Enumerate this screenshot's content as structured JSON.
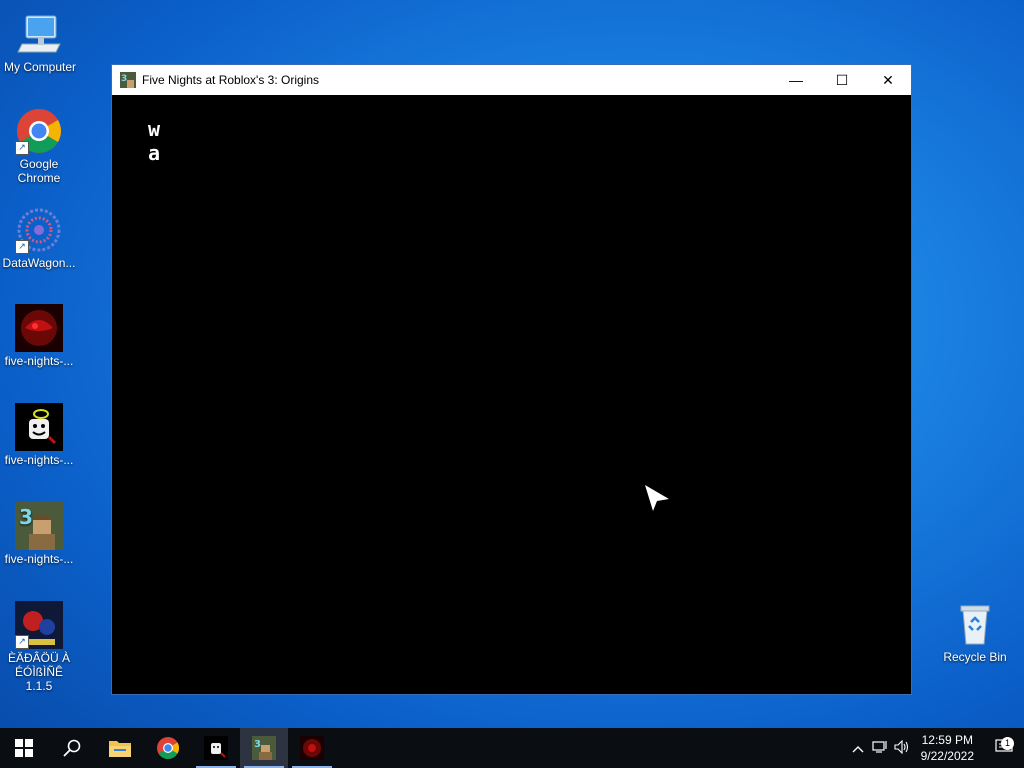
{
  "desktop": {
    "icons": [
      {
        "label": "My Computer"
      },
      {
        "label": "Google Chrome"
      },
      {
        "label": "DataWagon..."
      },
      {
        "label": "five-nights-..."
      },
      {
        "label": "five-nights-..."
      },
      {
        "label": "five-nights-..."
      },
      {
        "label": "ÈÄÐÂÖÜ À ÉÓÌßÌÑÊ 1.1.5"
      },
      {
        "label": "Recycle Bin"
      }
    ]
  },
  "window": {
    "title": "Five Nights at Roblox's 3: Origins",
    "minimize": "—",
    "maximize": "☐",
    "close": "✕",
    "game_text_line1": "w",
    "game_text_line2": "a"
  },
  "taskbar": {
    "items": [
      "start-button",
      "search-button",
      "file-explorer",
      "chrome",
      "five-nights-game-1",
      "five-nights-game-3",
      "five-nights-game-red"
    ],
    "active_index": 5,
    "clock_time": "12:59 PM",
    "clock_date": "9/22/2022",
    "notification_count": "1"
  },
  "colors": {
    "accent": "#0b5fc8",
    "taskbar_bg": "#0a0d12"
  }
}
